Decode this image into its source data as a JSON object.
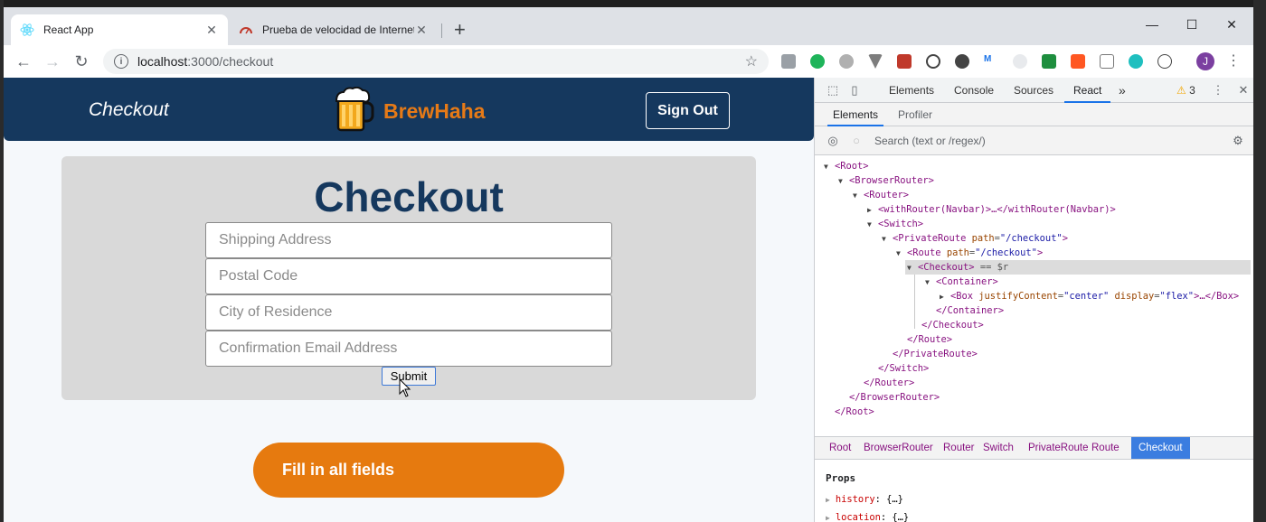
{
  "browser": {
    "tabs": [
      {
        "title": "React App",
        "icon": "react-icon",
        "active": true
      },
      {
        "title": "Prueba de velocidad de Internet",
        "icon": "speedtest-icon",
        "active": false
      }
    ],
    "address": {
      "host": "localhost",
      "rest": ":3000/checkout"
    },
    "profile_initial": "J"
  },
  "app": {
    "nav_title": "Checkout",
    "brand": "BrewHaha",
    "signout_label": "Sign Out",
    "card_title": "Checkout",
    "fields": [
      {
        "placeholder": "Shipping Address"
      },
      {
        "placeholder": "Postal Code"
      },
      {
        "placeholder": "City of Residence"
      },
      {
        "placeholder": "Confirmation Email Address"
      }
    ],
    "submit_label": "Submit",
    "alert_text": "Fill in all fields",
    "colors": {
      "navbar": "#15385e",
      "brand": "#e67a17",
      "alert": "#e67a0f",
      "card": "#d9d9d9"
    }
  },
  "devtools": {
    "tabs": [
      "Elements",
      "Console",
      "Sources",
      "React"
    ],
    "active_tab": "React",
    "overflow": "»",
    "warning_count": "3",
    "subtabs": [
      "Elements",
      "Profiler"
    ],
    "active_subtab": "Elements",
    "search_placeholder": "Search (text or /regex/)",
    "tree": [
      {
        "open": "▼",
        "tag": "<Root>"
      },
      {
        "open": "▼",
        "tag": "<BrowserRouter>"
      },
      {
        "open": "▼",
        "tag": "<Router>"
      },
      {
        "open": "▶",
        "tag": "<withRouter(Navbar)>",
        "tail": "…</withRouter(Navbar)>"
      },
      {
        "open": "▼",
        "tag": "<Switch>"
      },
      {
        "open": "▼",
        "tag": "<PrivateRoute",
        "attr": "path",
        "val": "\"/checkout\"",
        "close": ">"
      },
      {
        "open": "▼",
        "tag": "<Route",
        "attr": "path",
        "val": "\"/checkout\"",
        "close": ">"
      },
      {
        "open": "▼",
        "tag": "<Checkout>",
        "tail": " == $r"
      },
      {
        "open": "▼",
        "tag": "<Container>"
      },
      {
        "open": "▶",
        "tag": "<Box",
        "attr": "justifyContent",
        "val": "\"center\"",
        "attr2": "display",
        "val2": "\"flex\"",
        "close": ">",
        "tail": "…</Box>"
      },
      {
        "open": "",
        "tag": "</Container>"
      },
      {
        "open": "",
        "tag": "</Checkout>"
      },
      {
        "open": "",
        "tag": "</Route>"
      },
      {
        "open": "",
        "tag": "</PrivateRoute>"
      },
      {
        "open": "",
        "tag": "</Switch>"
      },
      {
        "open": "",
        "tag": "</Router>"
      },
      {
        "open": "",
        "tag": "</BrowserRouter>"
      },
      {
        "open": "",
        "tag": "</Root>"
      }
    ],
    "breadcrumbs": [
      "Root",
      "BrowserRouter",
      "Router",
      "Switch",
      "PrivateRoute",
      "Route",
      "Checkout"
    ],
    "active_breadcrumb": "Checkout",
    "props_label": "Props",
    "props": [
      {
        "key": "history",
        "value": "{…}"
      },
      {
        "key": "location",
        "value": "{…}"
      }
    ]
  }
}
